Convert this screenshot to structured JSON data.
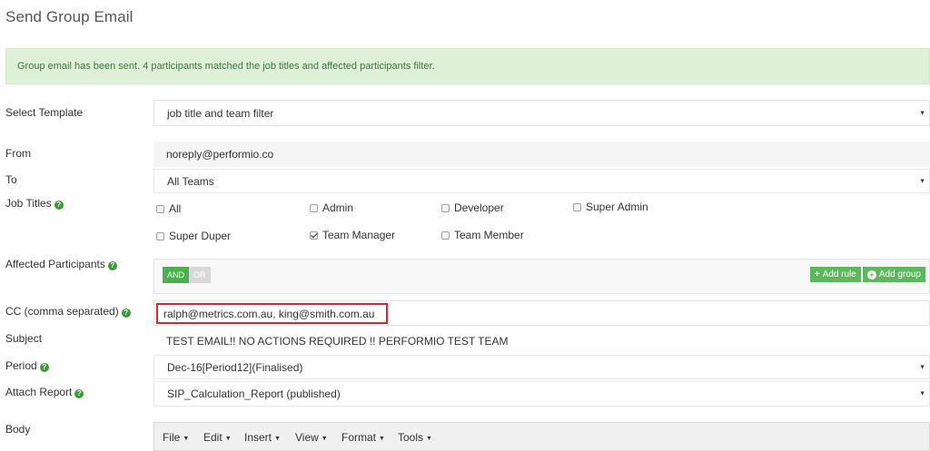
{
  "page": {
    "title": "Send Group Email"
  },
  "alert": {
    "message": "Group email has been sent. 4 participants matched the job titles and affected participants filter."
  },
  "template": {
    "label": "Select Template",
    "value": "job title and team filter"
  },
  "from": {
    "label": "From",
    "value": "noreply@performio.co"
  },
  "to": {
    "label": "To",
    "value": "All Teams"
  },
  "job_titles": {
    "label": "Job Titles",
    "options": [
      {
        "label": "All",
        "checked": false
      },
      {
        "label": "Admin",
        "checked": false
      },
      {
        "label": "Developer",
        "checked": false
      },
      {
        "label": "Super Admin",
        "checked": false
      },
      {
        "label": "Super Duper",
        "checked": false
      },
      {
        "label": "Team Manager",
        "checked": true
      },
      {
        "label": "Team Member",
        "checked": false
      }
    ]
  },
  "affected": {
    "label": "Affected Participants",
    "and_label": "AND",
    "or_label": "OR",
    "add_rule": "Add rule",
    "add_group": "Add group"
  },
  "cc": {
    "label": "CC (comma separated)",
    "value": "ralph@metrics.com.au, king@smith.com.au"
  },
  "subject": {
    "label": "Subject",
    "value": "TEST EMAIL!! NO ACTIONS REQUIRED !! PERFORMIO TEST TEAM"
  },
  "period": {
    "label": "Period",
    "value": "Dec-16[Period12](Finalised)"
  },
  "attach_report": {
    "label": "Attach Report",
    "value": "SIP_Calculation_Report (published)"
  },
  "body": {
    "label": "Body",
    "menus": [
      "File",
      "Edit",
      "Insert",
      "View",
      "Format",
      "Tools"
    ]
  },
  "icons": {
    "help": "question-circle-icon",
    "dropdown": "caret-down-icon",
    "plus": "plus-icon",
    "plus_circle": "plus-circle-icon"
  },
  "colors": {
    "alert_bg": "#dff0d8",
    "alert_text": "#3c763d",
    "success": "#5cb85c",
    "highlight": "#d9252c"
  }
}
